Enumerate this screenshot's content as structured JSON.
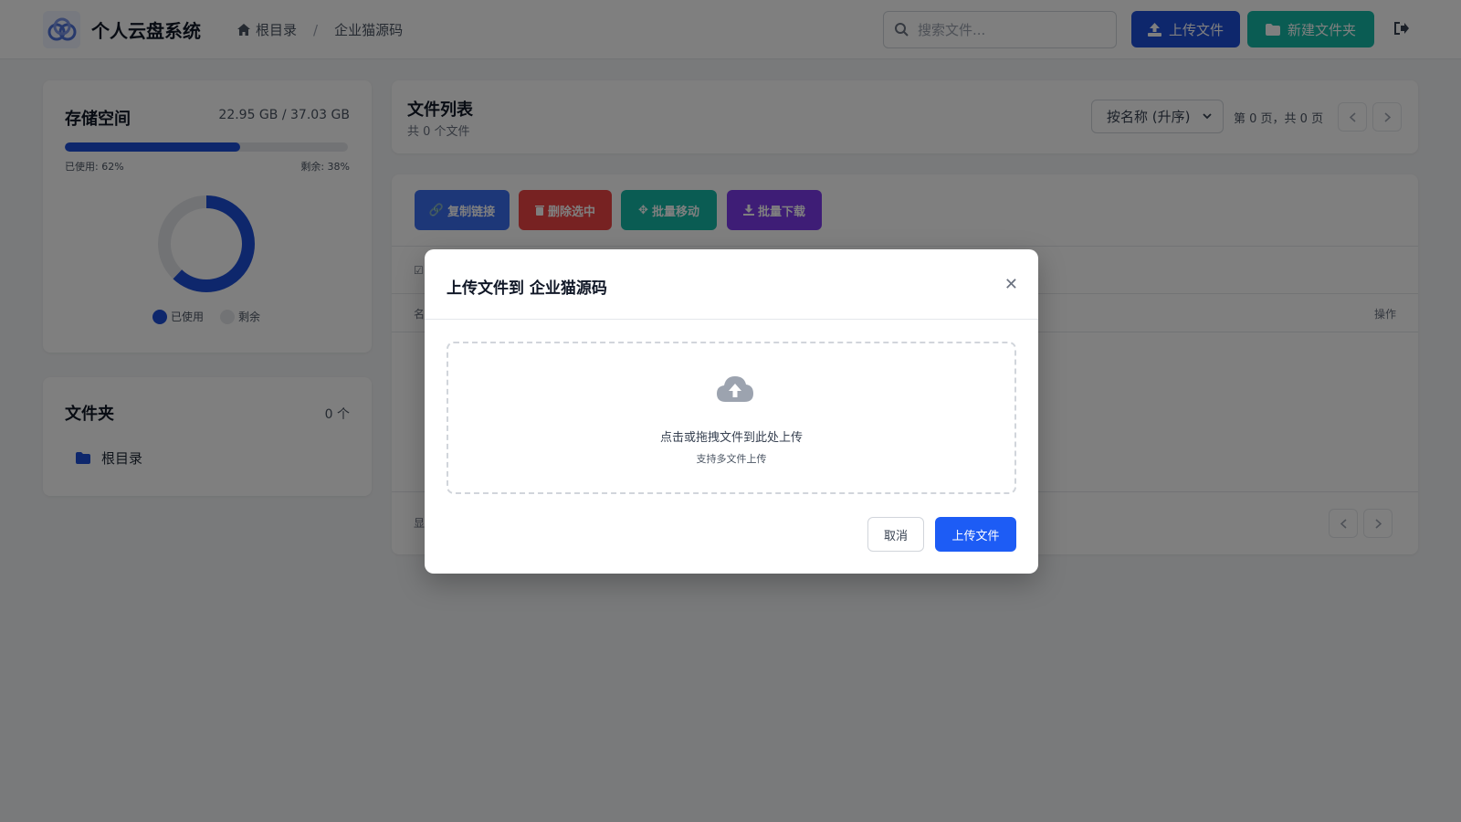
{
  "header": {
    "app_title": "个人云盘系统",
    "breadcrumb": {
      "root": "根目录",
      "separator": "/",
      "current": "企业猫源码"
    },
    "search_placeholder": "搜索文件...",
    "upload_label": "上传文件",
    "new_folder_label": "新建文件夹"
  },
  "storage": {
    "title": "存储空间",
    "amount": "22.95 GB / 37.03 GB",
    "used_label": "已使用: 62%",
    "remain_label": "剩余: 38%",
    "used_fraction": 0.62,
    "legend_used": "已使用",
    "legend_remain": "剩余"
  },
  "folders": {
    "title": "文件夹",
    "count": "0 个",
    "items": [
      {
        "label": "根目录"
      }
    ]
  },
  "file_list": {
    "title": "文件列表",
    "subtitle": "共 0 个文件",
    "sort_value": "按名称 (升序)",
    "page_info": "第 0 页，共 0 页",
    "actions": {
      "copy_link": "复制链接",
      "delete_selected": "删除选中",
      "batch_move": "批量移动",
      "batch_download": "批量下载"
    },
    "col_name": "名",
    "col_ops": "操作",
    "footer_show": "显"
  },
  "modal": {
    "title": "上传文件到 企业猫源码",
    "drop_text": "点击或拖拽文件到此处上传",
    "drop_sub": "支持多文件上传",
    "cancel_label": "取消",
    "submit_label": "上传文件"
  },
  "colors": {
    "primary": "#1d4ed8",
    "teal": "#14b8a6",
    "danger": "#ef4444",
    "purple": "#7c3aed",
    "submit": "#1d5cf5"
  }
}
